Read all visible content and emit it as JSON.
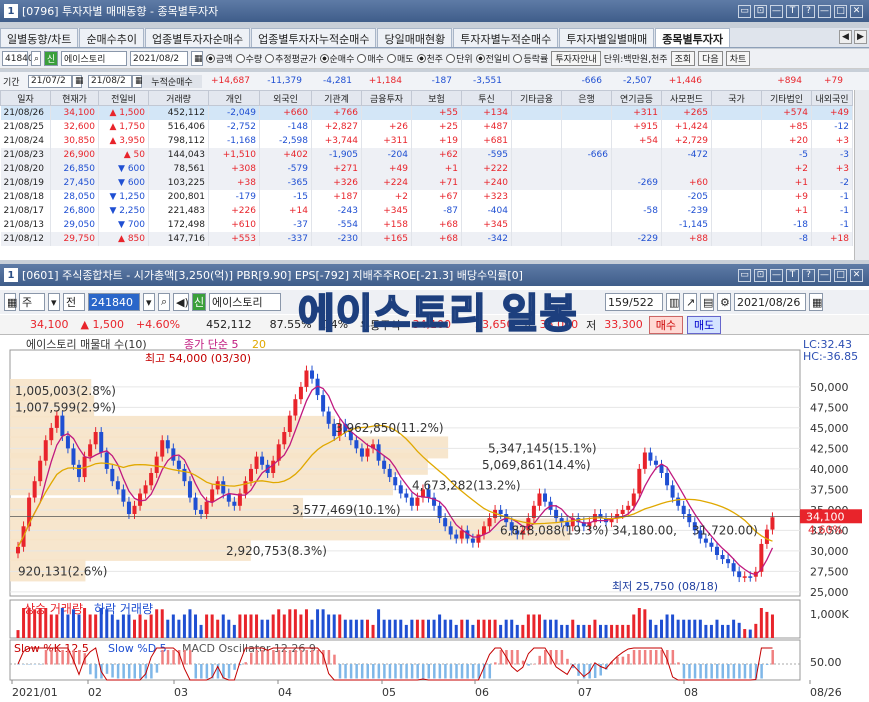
{
  "window1": {
    "num": "1",
    "title": "[0796] 투자자별 매매동향 - 종목별투자자",
    "controls": [
      "▭",
      "⊡",
      "—",
      "T",
      "?",
      "—",
      "□",
      "✕"
    ]
  },
  "tabs": [
    "일별동향/차트",
    "순매수추이",
    "업종별투자자순매수",
    "업종별투자자누적순매수",
    "당일매매현황",
    "투자자별누적순매수",
    "투자자별일별매매",
    "종목별투자자"
  ],
  "tabnav": [
    "◀",
    "▶"
  ],
  "toolbar1": {
    "code": "41840",
    "stock_tag": "신",
    "stock_name": "에이스토리",
    "date": "2021/08/2",
    "radios": [
      "금액",
      "수량",
      "추정평균가",
      "순매수",
      "매수",
      "매도",
      "천주",
      "단위",
      "전일비",
      "등락률",
      "투자자안내"
    ],
    "unit_text": "단위:백만원,천주",
    "btn_query": "조회",
    "btn_next": "다음",
    "btn_chart": "차트"
  },
  "date_row": {
    "label": "기간",
    "from": "21/07/2",
    "to": "21/08/2",
    "cum_label": "누적순매수",
    "cum_values": [
      "+14,687",
      "-11,379",
      "-4,281",
      "+1,184",
      "-187",
      "-3,551",
      "",
      "-666",
      "-2,507",
      "+1,446",
      "",
      "+894",
      "+79"
    ]
  },
  "grid": {
    "headers": [
      "일자",
      "현재가",
      "전일비",
      "거래량",
      "개인",
      "외국인",
      "기관계",
      "금융투자",
      "보험",
      "투신",
      "기타금융",
      "은행",
      "연기금등",
      "사모펀드",
      "국가",
      "기타법인",
      "내외국인"
    ],
    "rows": [
      [
        "21/08/26",
        "34,100",
        "1,500",
        "452,112",
        "-2,049",
        "+660",
        "+766",
        "",
        "+55",
        "+134",
        "",
        "",
        "+311",
        "+265",
        "",
        "+574",
        "+49"
      ],
      [
        "21/08/25",
        "32,600",
        "1,750",
        "516,406",
        "-2,752",
        "-148",
        "+2,827",
        "+26",
        "+25",
        "+487",
        "",
        "",
        "+915",
        "+1,424",
        "",
        "+85",
        "-12"
      ],
      [
        "21/08/24",
        "30,850",
        "3,950",
        "798,112",
        "-1,168",
        "-2,598",
        "+3,744",
        "+311",
        "+19",
        "+681",
        "",
        "",
        "+54",
        "+2,729",
        "",
        "+20",
        "+3"
      ],
      [
        "21/08/23",
        "26,900",
        "50",
        "144,043",
        "+1,510",
        "+402",
        "-1,905",
        "-204",
        "+62",
        "-595",
        "",
        "-666",
        "",
        "-472",
        "",
        "-5",
        "-3"
      ],
      [
        "21/08/20",
        "26,850",
        "600",
        "78,561",
        "+308",
        "-579",
        "+271",
        "+49",
        "+1",
        "+222",
        "",
        "",
        "",
        "",
        "",
        "+2",
        "+3"
      ],
      [
        "21/08/19",
        "27,450",
        "600",
        "103,225",
        "+38",
        "-365",
        "+326",
        "+224",
        "+71",
        "+240",
        "",
        "",
        "-269",
        "+60",
        "",
        "+1",
        "-2"
      ],
      [
        "21/08/18",
        "28,050",
        "1,250",
        "200,801",
        "-179",
        "-15",
        "+187",
        "+2",
        "+67",
        "+323",
        "",
        "",
        "",
        "-205",
        "",
        "+9",
        "-1"
      ],
      [
        "21/08/17",
        "26,800",
        "2,250",
        "221,483",
        "+226",
        "+14",
        "-243",
        "+345",
        "-87",
        "-404",
        "",
        "",
        "-58",
        "-239",
        "",
        "+1",
        "-1"
      ],
      [
        "21/08/13",
        "29,050",
        "700",
        "172,498",
        "+610",
        "-37",
        "-554",
        "+158",
        "+68",
        "+345",
        "",
        "",
        "",
        "-1,145",
        "",
        "-18",
        "-1"
      ],
      [
        "21/08/12",
        "29,750",
        "850",
        "147,716",
        "+553",
        "-337",
        "-230",
        "+165",
        "+68",
        "-342",
        "",
        "",
        "-229",
        "+88",
        "",
        "-8",
        "+18"
      ]
    ],
    "change_dirs": [
      "up",
      "up",
      "up",
      "up",
      "dn",
      "dn",
      "dn",
      "dn",
      "dn",
      "up"
    ],
    "row_styles": [
      "sel",
      "",
      "",
      "alt",
      "alt",
      "alt",
      "",
      "",
      "",
      "alt"
    ]
  },
  "window2": {
    "num": "1",
    "title": "[0601] 주식종합차트 - 시가총액[3,250(억)] PBR[9.90] EPS[-792] 지배주주ROE[-21.3] 배당수익률[0]",
    "controls": [
      "▭",
      "⊡",
      "—",
      "T",
      "?",
      "—",
      "□",
      "✕"
    ]
  },
  "toolbar2": {
    "kind": "주",
    "jeon": "전",
    "code": "241840",
    "stock_tag": "신",
    "stock_name": "에이스토리",
    "count": "159/522",
    "date": "2021/08/26"
  },
  "overlay_title": "에이스토리 일봉",
  "quote": {
    "price": "34,100",
    "change": "▲ 1,500",
    "pct": "+4.60%",
    "volume": "452,112",
    "rate": "87.55%",
    "misc": "74%",
    "misc2": "유통주식",
    "open": "34,100",
    "prev_close": "33,650",
    "high_label": "고",
    "high": "35,000",
    "low_label": "저",
    "low": "33,300",
    "buy": "매수",
    "sell": "매도"
  },
  "chart_data": {
    "type": "candlestick",
    "title": "에이스토리 매물대 수(10)",
    "legend": [
      {
        "name": "종가 단순 5",
        "color": "#c0197f"
      },
      {
        "name": "20",
        "color": "#e0a800"
      }
    ],
    "right_labels": {
      "lc": "LC:32.43",
      "hc": "HC:-36.85"
    },
    "y_ticks": [
      50000,
      47500,
      45000,
      42500,
      40000,
      37500,
      35000,
      32500,
      30000,
      27500,
      25000
    ],
    "ylim": [
      24500,
      54500
    ],
    "x_labels": [
      "2021/01",
      "02",
      "03",
      "04",
      "05",
      "06",
      "07",
      "08",
      "08/26"
    ],
    "current_price_label": "34,100",
    "current_pct_label": "4.60%",
    "high_annotation": "최고 54,000 (03/30)",
    "low_annotation": "최저 25,750 (08/18)",
    "volume_profile": [
      {
        "label": "1,005,003(2.8%)",
        "price": 49500
      },
      {
        "label": "1,007,599(2.9%)",
        "price": 47500
      },
      {
        "label": "3,962,850(11.2%)",
        "price": 45000
      },
      {
        "label": "5,347,145(15.1%)",
        "price": 42500
      },
      {
        "label": "5,069,861(14.4%)",
        "price": 40500
      },
      {
        "label": "4,673,282(13.2%)",
        "price": 38000
      },
      {
        "label": "3,577,469(10.1%)",
        "price": 35000
      },
      {
        "label": "6,828,088(19.3%)",
        "price": 32500
      },
      {
        "label": "2,920,753(8.3%)",
        "price": 30000
      },
      {
        "label": "920,131(2.6%)",
        "price": 27500
      }
    ],
    "support_labels": [
      "34,180.00",
      "31,720.00"
    ],
    "closes": [
      30500,
      33000,
      36500,
      38500,
      41000,
      43500,
      45000,
      46500,
      44000,
      42500,
      40500,
      39000,
      41500,
      43000,
      44500,
      42000,
      40000,
      38500,
      37500,
      36000,
      34500,
      35500,
      37000,
      38000,
      39500,
      41500,
      43500,
      42500,
      41000,
      40000,
      38500,
      36500,
      35000,
      34500,
      36000,
      37500,
      38500,
      37000,
      36000,
      35500,
      37000,
      38500,
      40000,
      41500,
      40500,
      39500,
      41000,
      43000,
      44500,
      46500,
      48500,
      50000,
      52000,
      51000,
      49000,
      47000,
      45500,
      44000,
      45500,
      44500,
      43500,
      42500,
      41500,
      42500,
      43000,
      41000,
      40000,
      39000,
      38000,
      37000,
      36500,
      35500,
      36500,
      37500,
      36500,
      35500,
      34000,
      33000,
      32000,
      31500,
      32500,
      31500,
      31000,
      32000,
      33000,
      34000,
      35000,
      34500,
      33500,
      32500,
      32000,
      32500,
      34000,
      35500,
      37000,
      36000,
      35000,
      34000,
      33500,
      33000,
      34000,
      33500,
      33000,
      33500,
      34500,
      34000,
      33500,
      34000,
      34500,
      35000,
      35500,
      37000,
      40000,
      42000,
      41000,
      40500,
      39500,
      38000,
      36500,
      35500,
      34500,
      33500,
      32500,
      31500,
      31000,
      30500,
      29500,
      29000,
      28500,
      27500,
      26800,
      26900,
      26850,
      27450,
      30850,
      32600,
      34100
    ],
    "volume_legend": [
      "상승 거래량",
      "하락 거래량"
    ],
    "volume_tick": "1,000K",
    "osc_legend": [
      "Slow %K 12,5",
      "Slow %D 5",
      "MACD Oscillator 12,26,9"
    ],
    "osc_tick": "50.00"
  }
}
